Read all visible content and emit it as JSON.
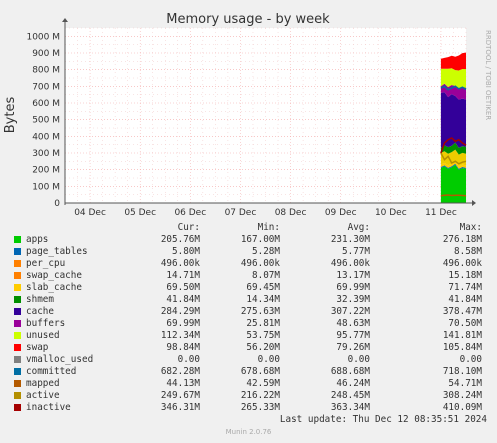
{
  "chart_data": {
    "type": "area",
    "title": "Memory usage - by week",
    "ylabel": "Bytes",
    "side_label": "RRDTOOL / TOBI OETIKER",
    "y_ticks": [
      "0",
      "100 M",
      "200 M",
      "300 M",
      "400 M",
      "500 M",
      "600 M",
      "700 M",
      "800 M",
      "900 M",
      "1000 M"
    ],
    "ylim": [
      0,
      1050
    ],
    "y_unit": "M",
    "x_ticks": [
      "04 Dec",
      "05 Dec",
      "06 Dec",
      "07 Dec",
      "08 Dec",
      "09 Dec",
      "10 Dec",
      "11 Dec"
    ],
    "x_range_days": [
      3.5,
      11.5
    ],
    "data_start_day": 11.0,
    "grid": true,
    "stack": [
      {
        "name": "apps",
        "color": "#00cc00",
        "values": [
          210,
          220,
          205,
          215,
          230,
          200,
          210,
          205
        ]
      },
      {
        "name": "page_tables",
        "color": "#0066b3",
        "values": [
          5.8,
          5.8,
          5.8,
          5.8,
          5.8,
          5.8,
          5.8,
          5.8
        ]
      },
      {
        "name": "per_cpu",
        "color": "#ff8000",
        "values": [
          0.5,
          0.5,
          0.5,
          0.5,
          0.5,
          0.5,
          0.5,
          0.5
        ]
      },
      {
        "name": "swap_cache",
        "color": "#ffcc00",
        "values": [
          14,
          14,
          14,
          14,
          14,
          14,
          14,
          14
        ]
      },
      {
        "name": "slab_cache",
        "color": "#eecc00",
        "values": [
          70,
          70,
          70,
          70,
          70,
          70,
          70,
          70
        ]
      },
      {
        "name": "shmem",
        "color": "#008f00",
        "values": [
          30,
          35,
          40,
          38,
          42,
          40,
          41,
          42
        ]
      },
      {
        "name": "cache",
        "color": "#330099",
        "values": [
          330,
          320,
          300,
          310,
          280,
          290,
          285,
          284
        ]
      },
      {
        "name": "buffers",
        "color": "#990099",
        "values": [
          40,
          50,
          60,
          55,
          60,
          65,
          70,
          70
        ]
      },
      {
        "name": "unused",
        "color": "#ccff00",
        "values": [
          105,
          90,
          110,
          100,
          95,
          110,
          108,
          112
        ]
      },
      {
        "name": "swap",
        "color": "#ff0000",
        "values": [
          60,
          65,
          70,
          75,
          80,
          90,
          95,
          99
        ]
      }
    ],
    "lines": [
      {
        "name": "committed",
        "color": "#006ea3",
        "values": [
          690,
          700,
          680,
          690,
          700,
          685,
          695,
          682
        ]
      },
      {
        "name": "mapped",
        "color": "#b35a00",
        "values": [
          44,
          46,
          48,
          45,
          47,
          46,
          45,
          44
        ]
      },
      {
        "name": "active",
        "color": "#b38f00",
        "values": [
          300,
          260,
          280,
          240,
          250,
          235,
          245,
          250
        ]
      },
      {
        "name": "inactive",
        "color": "#a50000",
        "values": [
          300,
          360,
          380,
          390,
          370,
          380,
          360,
          346
        ]
      }
    ]
  },
  "legend": {
    "headers": {
      "cur": "Cur:",
      "min": "Min:",
      "avg": "Avg:",
      "max": "Max:"
    },
    "rows": [
      {
        "name": "apps",
        "color": "#00cc00",
        "cur": "205.76M",
        "min": "167.00M",
        "avg": "231.30M",
        "max": "276.18M"
      },
      {
        "name": "page_tables",
        "color": "#0066b3",
        "cur": "5.80M",
        "min": "5.28M",
        "avg": "5.77M",
        "max": "8.58M"
      },
      {
        "name": "per_cpu",
        "color": "#ff8000",
        "cur": "496.00k",
        "min": "496.00k",
        "avg": "496.00k",
        "max": "496.00k"
      },
      {
        "name": "swap_cache",
        "color": "#ff8000",
        "cur": "14.71M",
        "min": "8.07M",
        "avg": "13.17M",
        "max": "15.18M"
      },
      {
        "name": "slab_cache",
        "color": "#ffcc00",
        "cur": "69.50M",
        "min": "69.45M",
        "avg": "69.99M",
        "max": "71.74M"
      },
      {
        "name": "shmem",
        "color": "#008f00",
        "cur": "41.84M",
        "min": "14.34M",
        "avg": "32.39M",
        "max": "41.84M"
      },
      {
        "name": "cache",
        "color": "#330099",
        "cur": "284.29M",
        "min": "275.63M",
        "avg": "307.22M",
        "max": "378.47M"
      },
      {
        "name": "buffers",
        "color": "#990099",
        "cur": "69.99M",
        "min": "25.81M",
        "avg": "48.63M",
        "max": "70.50M"
      },
      {
        "name": "unused",
        "color": "#ccff00",
        "cur": "112.34M",
        "min": "53.75M",
        "avg": "95.77M",
        "max": "141.81M"
      },
      {
        "name": "swap",
        "color": "#ff0000",
        "cur": "98.84M",
        "min": "56.20M",
        "avg": "79.26M",
        "max": "105.84M"
      },
      {
        "name": "vmalloc_used",
        "color": "#808080",
        "cur": "0.00",
        "min": "0.00",
        "avg": "0.00",
        "max": "0.00"
      },
      {
        "name": "committed",
        "color": "#006ea3",
        "cur": "682.28M",
        "min": "678.68M",
        "avg": "688.68M",
        "max": "718.10M"
      },
      {
        "name": "mapped",
        "color": "#b35a00",
        "cur": "44.13M",
        "min": "42.59M",
        "avg": "46.24M",
        "max": "54.71M"
      },
      {
        "name": "active",
        "color": "#b38f00",
        "cur": "249.67M",
        "min": "216.22M",
        "avg": "248.45M",
        "max": "308.24M"
      },
      {
        "name": "inactive",
        "color": "#a50000",
        "cur": "346.31M",
        "min": "265.33M",
        "avg": "363.34M",
        "max": "410.09M"
      }
    ]
  },
  "footer": {
    "last_update": "Last update: Thu Dec 12 08:35:51 2024",
    "generator": "Munin 2.0.76"
  }
}
